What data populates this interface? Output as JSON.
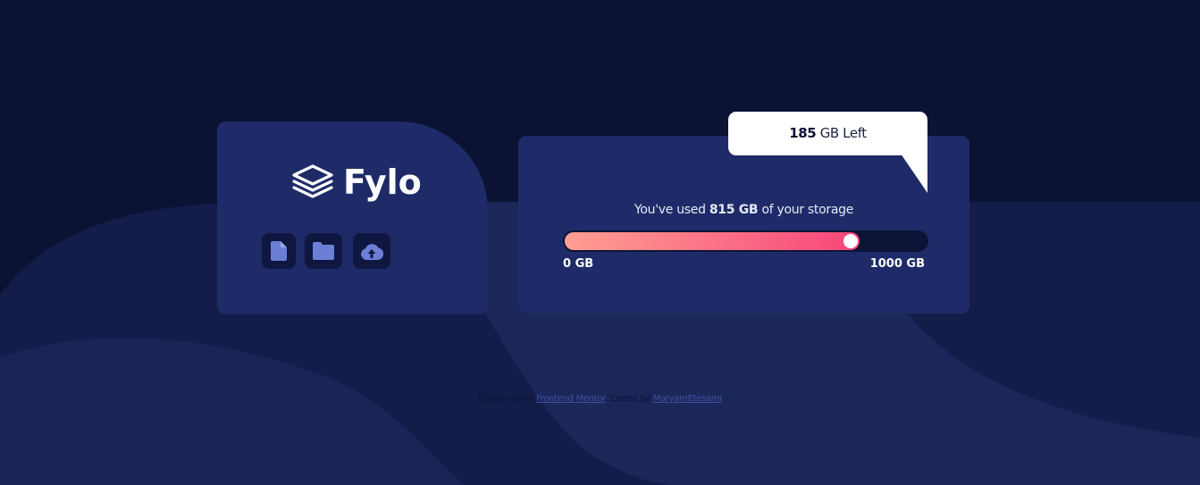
{
  "brand": {
    "name": "Fylo",
    "logo_icon": "layers-icon"
  },
  "toolbar": {
    "icons": [
      "document-icon",
      "folder-icon",
      "upload-cloud-icon"
    ]
  },
  "storage": {
    "used_prefix": "You've used",
    "used_value": "815 GB",
    "used_suffix": "of your storage",
    "used_gb": 815,
    "total_gb": 1000,
    "min_label": "0 GB",
    "max_label": "1000 GB"
  },
  "bubble": {
    "remaining_value": "185",
    "remaining_suffix": "GB Left"
  },
  "footer": {
    "prefix": "Challenge by",
    "challenge_link": "Frontend Mentor",
    "middle": ". Coded by",
    "author_link": "MaryamEtesami"
  },
  "colors": {
    "background": "#0c1233",
    "card": "#1e2b68",
    "icon_tile": "#0f1740",
    "icon_fill": "#6b7fd7",
    "gradient_start": "#ff9f92",
    "gradient_end": "#f6467a",
    "link": "#3e52a3"
  }
}
